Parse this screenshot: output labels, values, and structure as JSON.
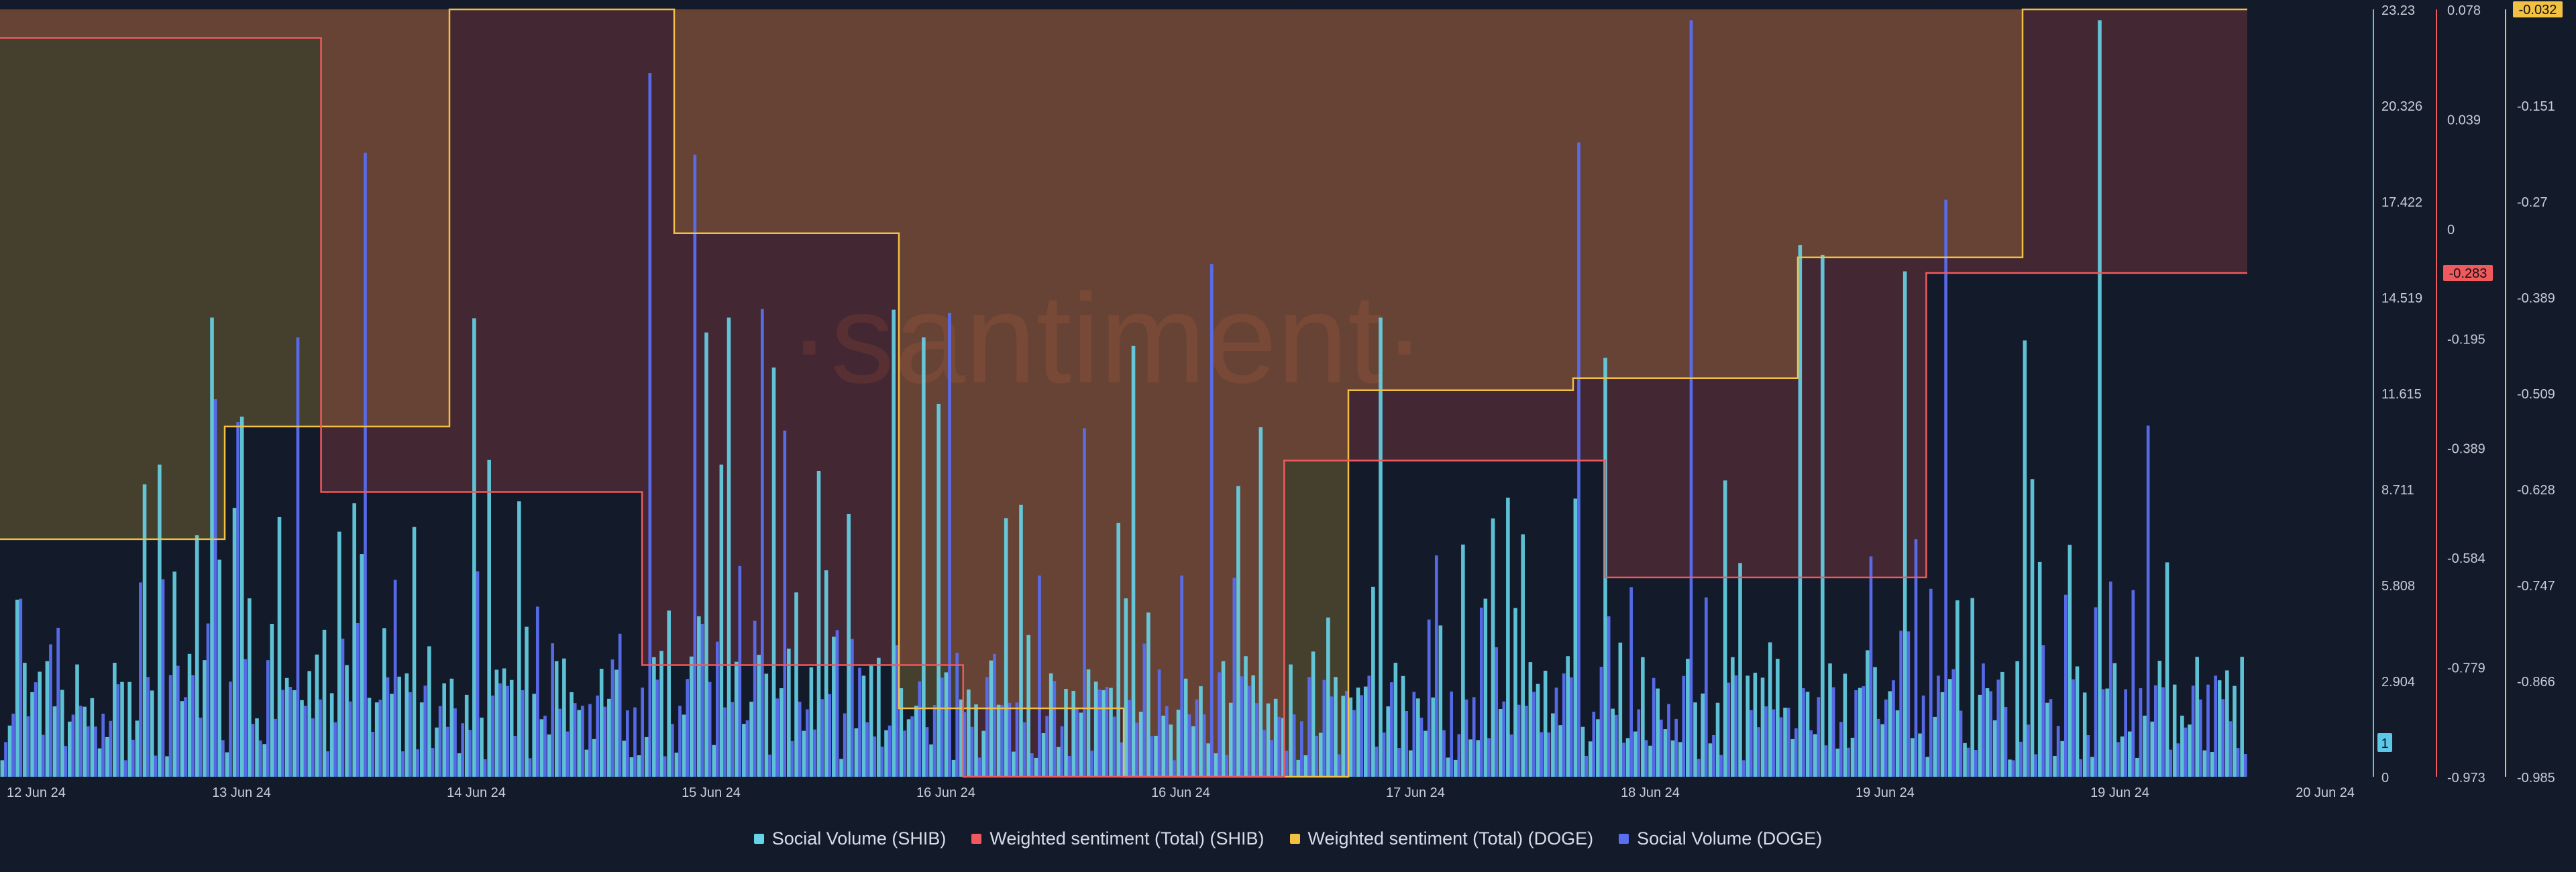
{
  "watermark": "·santiment·",
  "badge_count": "1",
  "chart_data": {
    "type": "bar",
    "grid": true,
    "legend_position": "bottom-center",
    "x": {
      "start": "2024-06-12",
      "end": "2024-06-20",
      "tick_labels": [
        "12 Jun 24",
        "13 Jun 24",
        "14 Jun 24",
        "15 Jun 24",
        "16 Jun 24",
        "16 Jun 24",
        "17 Jun 24",
        "18 Jun 24",
        "19 Jun 24",
        "19 Jun 24",
        "20 Jun 24"
      ]
    },
    "axes": {
      "volume": {
        "ylim": [
          0,
          23.23
        ],
        "tick_labels": [
          "23.23",
          "20.326",
          "17.422",
          "14.519",
          "11.615",
          "8.711",
          "5.808",
          "2.904",
          "0"
        ],
        "color": "#5bc8e8"
      },
      "sentiment_shib": {
        "ylim": [
          -0.973,
          0.078
        ],
        "tick_labels": [
          "0.078",
          "0.039",
          "0",
          "-0.195",
          "-0.389",
          "-0.584",
          "-0.779",
          "-0.973"
        ],
        "current": "-0.283",
        "color": "#f0595d"
      },
      "sentiment_doge": {
        "ylim": [
          -0.985,
          -0.032
        ],
        "tick_labels": [
          "-0.032",
          "-0.151",
          "-0.27",
          "-0.389",
          "-0.509",
          "-0.628",
          "-0.747",
          "-0.866",
          "-0.985"
        ],
        "current": "-0.032",
        "color": "#f2c043"
      }
    },
    "series": [
      {
        "key": "shib_volume",
        "name": "Social Volume (SHIB)",
        "color": "#66d4e8",
        "axis": "volume",
        "kind": "bar"
      },
      {
        "key": "shib_sentiment",
        "name": "Weighted sentiment (Total) (SHIB)",
        "color": "#f0595d",
        "axis": "sentiment_shib",
        "kind": "step",
        "values": [
          0.039,
          -0.583,
          -0.82,
          -0.973,
          -0.54,
          -0.7,
          -0.283
        ]
      },
      {
        "key": "doge_sentiment",
        "name": "Weighted sentiment (Total) (DOGE)",
        "color": "#f2c043",
        "axis": "sentiment_doge",
        "kind": "step",
        "values": [
          -0.69,
          -0.55,
          -0.032,
          -0.31,
          -0.9,
          -0.985,
          -0.505,
          -0.49,
          -0.34,
          -0.032
        ]
      },
      {
        "key": "doge_volume",
        "name": "Social Volume (DOGE)",
        "color": "#5a6ef0",
        "axis": "volume",
        "kind": "bar"
      }
    ]
  }
}
